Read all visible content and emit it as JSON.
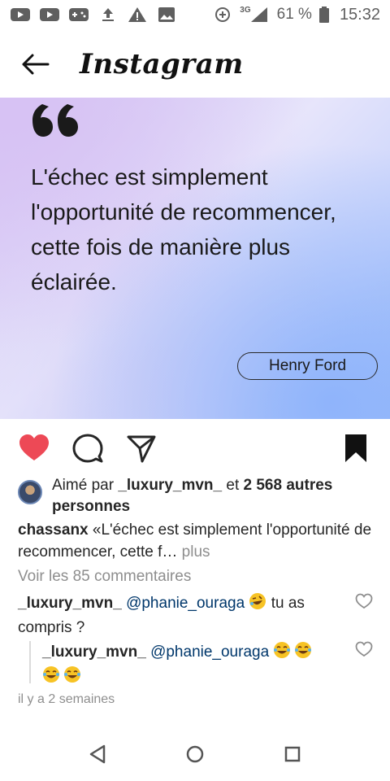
{
  "status_bar": {
    "icons": [
      "youtube-icon",
      "youtube-icon",
      "game-controller-icon",
      "upload-icon",
      "warning-icon",
      "image-icon",
      "data-saver-icon",
      "signal-3g-icon",
      "battery-icon"
    ],
    "network": "3G",
    "battery": "61 %",
    "time": "15:32"
  },
  "header": {
    "back_icon": "arrow-left-icon",
    "logo": "Instagram"
  },
  "post": {
    "quote": "L'échec est simplement l'opportunité de recommencer, cette fois de manière plus éclairée.",
    "author": "Henry Ford"
  },
  "actions": {
    "icons": [
      "heart-filled-icon",
      "comment-icon",
      "share-icon",
      "bookmark-filled-icon"
    ],
    "like_color": "#ed4956"
  },
  "likes": {
    "prefix": "Aimé par ",
    "user": "_luxury_mvn_",
    "middle": " et ",
    "count": "2 568 autres personnes"
  },
  "caption": {
    "username": "chassanx",
    "text": " «L'échec est simplement l'opportunité de recommencer, cette f…",
    "more": " plus"
  },
  "view_comments": "Voir les 85 commentaires",
  "comments": [
    {
      "username": "_luxury_mvn_",
      "mention": "@phanie_ouraga",
      "text": " tu as compris ?"
    },
    {
      "username": "_luxury_mvn_",
      "mention": "@phanie_ouraga",
      "text": ""
    }
  ],
  "timestamp": "il y a 2 semaines",
  "nav": [
    "back-triangle-icon",
    "home-circle-icon",
    "recents-square-icon"
  ]
}
